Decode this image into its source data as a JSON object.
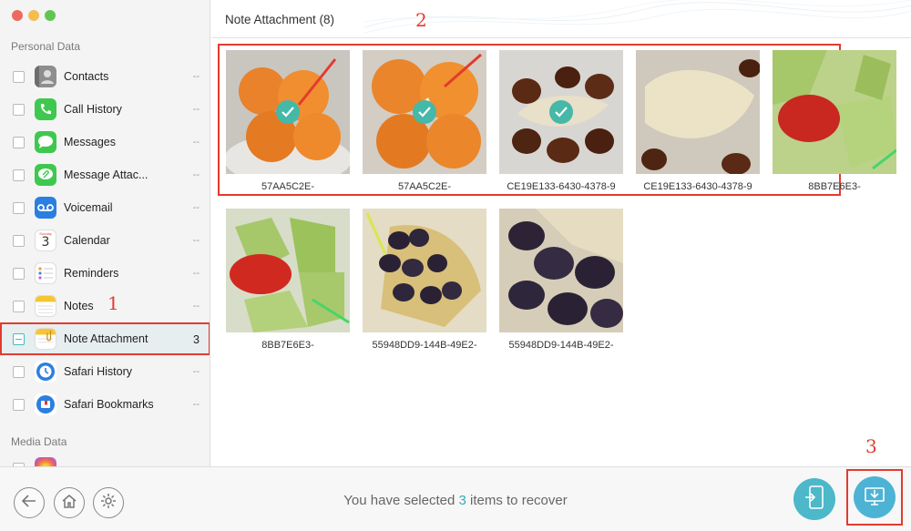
{
  "window": {
    "traffic_colors": [
      "#ee6a5f",
      "#f5bd4f",
      "#61c554"
    ]
  },
  "sidebar": {
    "personal_section": "Personal Data",
    "media_section": "Media Data",
    "items": [
      {
        "label": "Contacts",
        "count": "--",
        "icon": "contacts-icon"
      },
      {
        "label": "Call History",
        "count": "--",
        "icon": "phone-icon"
      },
      {
        "label": "Messages",
        "count": "--",
        "icon": "messages-icon"
      },
      {
        "label": "Message Attac...",
        "count": "--",
        "icon": "message-attachment-icon"
      },
      {
        "label": "Voicemail",
        "count": "--",
        "icon": "voicemail-icon"
      },
      {
        "label": "Calendar",
        "count": "--",
        "icon": "calendar-icon",
        "calendar_day": "Sunday",
        "calendar_date": "3"
      },
      {
        "label": "Reminders",
        "count": "--",
        "icon": "reminders-icon"
      },
      {
        "label": "Notes",
        "count": "--",
        "icon": "notes-icon"
      },
      {
        "label": "Note Attachment",
        "count": "3",
        "icon": "note-attachment-icon"
      },
      {
        "label": "Safari History",
        "count": "--",
        "icon": "safari-history-icon"
      },
      {
        "label": "Safari Bookmarks",
        "count": "--",
        "icon": "safari-bookmarks-icon"
      }
    ]
  },
  "main": {
    "title": "Note Attachment (8)",
    "tiles": [
      {
        "caption": "57AA5C2E-",
        "selected": true,
        "photo": "tangerine"
      },
      {
        "caption": "57AA5C2E-",
        "selected": true,
        "photo": "tangerine"
      },
      {
        "caption": "CE19E133-6430-4378-9",
        "selected": true,
        "photo": "dates-pear"
      },
      {
        "caption": "CE19E133-6430-4378-9",
        "selected": false,
        "photo": "pear"
      },
      {
        "caption": "8BB7E6E3-",
        "selected": false,
        "photo": "melon-tomato"
      },
      {
        "caption": "8BB7E6E3-",
        "selected": false,
        "photo": "melon-tomato"
      },
      {
        "caption": "55948DD9-144B-49E2-",
        "selected": false,
        "photo": "grapes-pomelo"
      },
      {
        "caption": "55948DD9-144B-49E2-",
        "selected": false,
        "photo": "grapes-pomelo"
      }
    ]
  },
  "annotations": {
    "one": "1",
    "two": "2",
    "three": "3"
  },
  "bottom": {
    "status_prefix": "You have selected ",
    "status_count": "3",
    "status_suffix": " items to recover",
    "accent": "#3aa9b6"
  }
}
